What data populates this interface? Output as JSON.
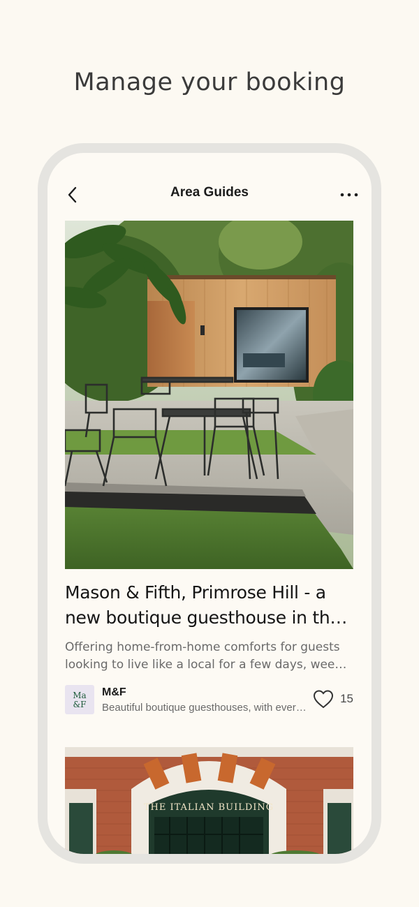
{
  "headline": "Manage your booking",
  "nav": {
    "title": "Area Guides",
    "back_icon": "chevron-left-icon",
    "more_icon": "ellipsis-icon"
  },
  "card": {
    "title": "Mason & Fifth, Primrose Hill - a new boutique guesthouse in the heart of Primrose Hill",
    "excerpt": "Offering home-from-home comforts for guests looking to live like a local for a few days, weeks or months",
    "author": "M&F",
    "avatar_text": "Ma &F",
    "tagline": "Beautiful boutique guesthouses, with everything you need",
    "likes": "15"
  },
  "card2": {
    "sign_text": "THE ITALIAN BUILDING"
  },
  "colors": {
    "background": "#fcf9f2",
    "phone_frame": "#e5e4e0",
    "avatar_bg": "#e9e4f0",
    "avatar_text": "#1f5c3c"
  }
}
